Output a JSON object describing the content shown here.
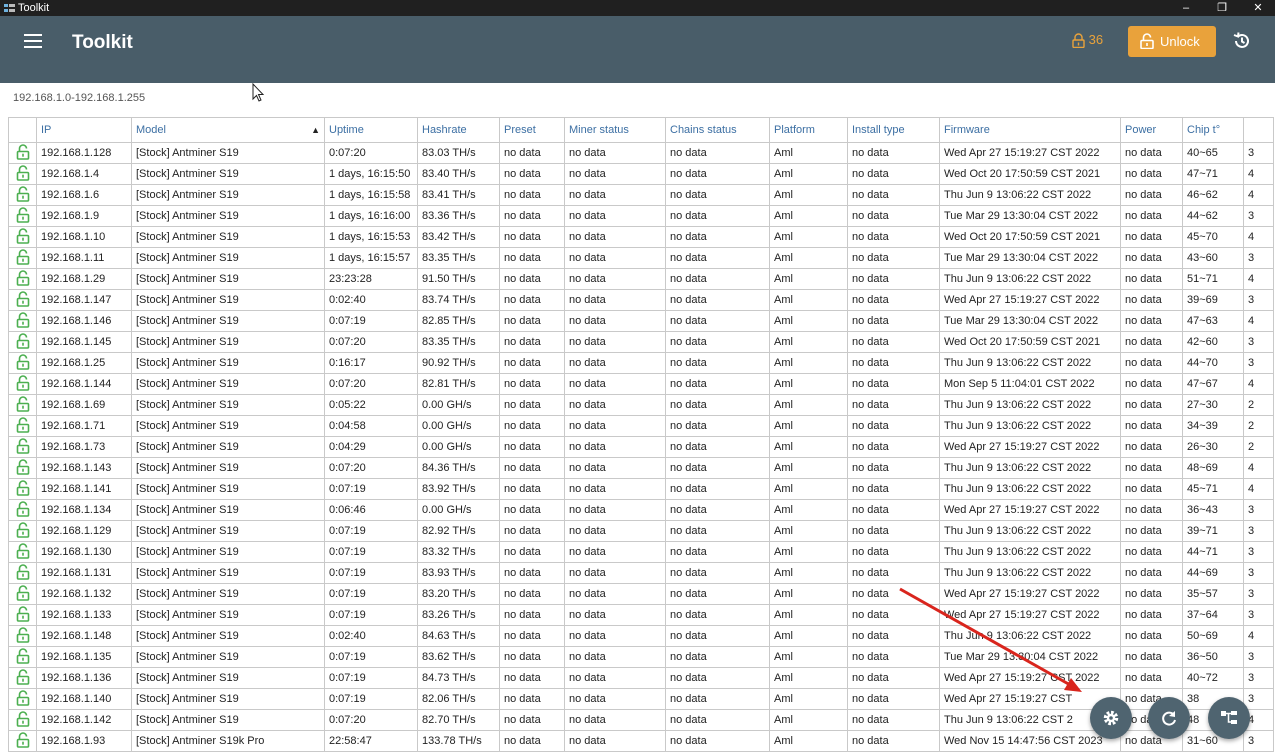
{
  "window": {
    "title": "Toolkit",
    "controls": [
      "–",
      "❐",
      "✕"
    ]
  },
  "header": {
    "title": "Toolkit",
    "lock_count": "36",
    "unlock_label": "Unlock"
  },
  "range": {
    "text": "192.168.1.0-192.168.1.255"
  },
  "table": {
    "columns": [
      "",
      "IP",
      "Model",
      "Uptime",
      "Hashrate",
      "Preset",
      "Miner status",
      "Chains status",
      "Platform",
      "Install type",
      "Firmware",
      "Power",
      "Chip t°",
      ""
    ],
    "sort_indicator": "▲",
    "rows": [
      [
        "192.168.1.128",
        "[Stock] Antminer S19",
        "0:07:20",
        "83.03 TH/s",
        "no data",
        "no data",
        "no data",
        "Aml",
        "no data",
        "Wed Apr 27 15:19:27 CST 2022",
        "no data",
        "40~65",
        "3"
      ],
      [
        "192.168.1.4",
        "[Stock] Antminer S19",
        "1 days, 16:15:50",
        "83.40 TH/s",
        "no data",
        "no data",
        "no data",
        "Aml",
        "no data",
        "Wed Oct 20 17:50:59 CST 2021",
        "no data",
        "47~71",
        "4"
      ],
      [
        "192.168.1.6",
        "[Stock] Antminer S19",
        "1 days, 16:15:58",
        "83.41 TH/s",
        "no data",
        "no data",
        "no data",
        "Aml",
        "no data",
        "Thu Jun  9 13:06:22 CST 2022",
        "no data",
        "46~62",
        "4"
      ],
      [
        "192.168.1.9",
        "[Stock] Antminer S19",
        "1 days, 16:16:00",
        "83.36 TH/s",
        "no data",
        "no data",
        "no data",
        "Aml",
        "no data",
        "Tue Mar 29 13:30:04 CST 2022",
        "no data",
        "44~62",
        "3"
      ],
      [
        "192.168.1.10",
        "[Stock] Antminer S19",
        "1 days, 16:15:53",
        "83.42 TH/s",
        "no data",
        "no data",
        "no data",
        "Aml",
        "no data",
        "Wed Oct 20 17:50:59 CST 2021",
        "no data",
        "45~70",
        "4"
      ],
      [
        "192.168.1.11",
        "[Stock] Antminer S19",
        "1 days, 16:15:57",
        "83.35 TH/s",
        "no data",
        "no data",
        "no data",
        "Aml",
        "no data",
        "Tue Mar 29 13:30:04 CST 2022",
        "no data",
        "43~60",
        "3"
      ],
      [
        "192.168.1.29",
        "[Stock] Antminer S19",
        "23:23:28",
        "91.50 TH/s",
        "no data",
        "no data",
        "no data",
        "Aml",
        "no data",
        "Thu Jun  9 13:06:22 CST 2022",
        "no data",
        "51~71",
        "4"
      ],
      [
        "192.168.1.147",
        "[Stock] Antminer S19",
        "0:02:40",
        "83.74 TH/s",
        "no data",
        "no data",
        "no data",
        "Aml",
        "no data",
        "Wed Apr 27 15:19:27 CST 2022",
        "no data",
        "39~69",
        "3"
      ],
      [
        "192.168.1.146",
        "[Stock] Antminer S19",
        "0:07:19",
        "82.85 TH/s",
        "no data",
        "no data",
        "no data",
        "Aml",
        "no data",
        "Tue Mar 29 13:30:04 CST 2022",
        "no data",
        "47~63",
        "4"
      ],
      [
        "192.168.1.145",
        "[Stock] Antminer S19",
        "0:07:20",
        "83.35 TH/s",
        "no data",
        "no data",
        "no data",
        "Aml",
        "no data",
        "Wed Oct 20 17:50:59 CST 2021",
        "no data",
        "42~60",
        "3"
      ],
      [
        "192.168.1.25",
        "[Stock] Antminer S19",
        "0:16:17",
        "90.92 TH/s",
        "no data",
        "no data",
        "no data",
        "Aml",
        "no data",
        "Thu Jun  9 13:06:22 CST 2022",
        "no data",
        "44~70",
        "3"
      ],
      [
        "192.168.1.144",
        "[Stock] Antminer S19",
        "0:07:20",
        "82.81 TH/s",
        "no data",
        "no data",
        "no data",
        "Aml",
        "no data",
        "Mon Sep  5 11:04:01 CST 2022",
        "no data",
        "47~67",
        "4"
      ],
      [
        "192.168.1.69",
        "[Stock] Antminer S19",
        "0:05:22",
        "0.00 GH/s",
        "no data",
        "no data",
        "no data",
        "Aml",
        "no data",
        "Thu Jun  9 13:06:22 CST 2022",
        "no data",
        "27~30",
        "2"
      ],
      [
        "192.168.1.71",
        "[Stock] Antminer S19",
        "0:04:58",
        "0.00 GH/s",
        "no data",
        "no data",
        "no data",
        "Aml",
        "no data",
        "Thu Jun  9 13:06:22 CST 2022",
        "no data",
        "34~39",
        "2"
      ],
      [
        "192.168.1.73",
        "[Stock] Antminer S19",
        "0:04:29",
        "0.00 GH/s",
        "no data",
        "no data",
        "no data",
        "Aml",
        "no data",
        "Wed Apr 27 15:19:27 CST 2022",
        "no data",
        "26~30",
        "2"
      ],
      [
        "192.168.1.143",
        "[Stock] Antminer S19",
        "0:07:20",
        "84.36 TH/s",
        "no data",
        "no data",
        "no data",
        "Aml",
        "no data",
        "Thu Jun  9 13:06:22 CST 2022",
        "no data",
        "48~69",
        "4"
      ],
      [
        "192.168.1.141",
        "[Stock] Antminer S19",
        "0:07:19",
        "83.92 TH/s",
        "no data",
        "no data",
        "no data",
        "Aml",
        "no data",
        "Thu Jun  9 13:06:22 CST 2022",
        "no data",
        "45~71",
        "4"
      ],
      [
        "192.168.1.134",
        "[Stock] Antminer S19",
        "0:06:46",
        "0.00 GH/s",
        "no data",
        "no data",
        "no data",
        "Aml",
        "no data",
        "Wed Apr 27 15:19:27 CST 2022",
        "no data",
        "36~43",
        "3"
      ],
      [
        "192.168.1.129",
        "[Stock] Antminer S19",
        "0:07:19",
        "82.92 TH/s",
        "no data",
        "no data",
        "no data",
        "Aml",
        "no data",
        "Thu Jun  9 13:06:22 CST 2022",
        "no data",
        "39~71",
        "3"
      ],
      [
        "192.168.1.130",
        "[Stock] Antminer S19",
        "0:07:19",
        "83.32 TH/s",
        "no data",
        "no data",
        "no data",
        "Aml",
        "no data",
        "Thu Jun  9 13:06:22 CST 2022",
        "no data",
        "44~71",
        "3"
      ],
      [
        "192.168.1.131",
        "[Stock] Antminer S19",
        "0:07:19",
        "83.93 TH/s",
        "no data",
        "no data",
        "no data",
        "Aml",
        "no data",
        "Thu Jun  9 13:06:22 CST 2022",
        "no data",
        "44~69",
        "3"
      ],
      [
        "192.168.1.132",
        "[Stock] Antminer S19",
        "0:07:19",
        "83.20 TH/s",
        "no data",
        "no data",
        "no data",
        "Aml",
        "no data",
        "Wed Apr 27 15:19:27 CST 2022",
        "no data",
        "35~57",
        "3"
      ],
      [
        "192.168.1.133",
        "[Stock] Antminer S19",
        "0:07:19",
        "83.26 TH/s",
        "no data",
        "no data",
        "no data",
        "Aml",
        "no data",
        "Wed Apr 27 15:19:27 CST 2022",
        "no data",
        "37~64",
        "3"
      ],
      [
        "192.168.1.148",
        "[Stock] Antminer S19",
        "0:02:40",
        "84.63 TH/s",
        "no data",
        "no data",
        "no data",
        "Aml",
        "no data",
        "Thu Jun  9 13:06:22 CST 2022",
        "no data",
        "50~69",
        "4"
      ],
      [
        "192.168.1.135",
        "[Stock] Antminer S19",
        "0:07:19",
        "83.62 TH/s",
        "no data",
        "no data",
        "no data",
        "Aml",
        "no data",
        "Tue Mar 29 13:30:04 CST 2022",
        "no data",
        "36~50",
        "3"
      ],
      [
        "192.168.1.136",
        "[Stock] Antminer S19",
        "0:07:19",
        "84.73 TH/s",
        "no data",
        "no data",
        "no data",
        "Aml",
        "no data",
        "Wed Apr 27 15:19:27 CST 2022",
        "no data",
        "40~72",
        "3"
      ],
      [
        "192.168.1.140",
        "[Stock] Antminer S19",
        "0:07:19",
        "82.06 TH/s",
        "no data",
        "no data",
        "no data",
        "Aml",
        "no data",
        "Wed Apr 27 15:19:27 CST",
        "no data",
        "38",
        "3"
      ],
      [
        "192.168.1.142",
        "[Stock] Antminer S19",
        "0:07:20",
        "82.70 TH/s",
        "no data",
        "no data",
        "no data",
        "Aml",
        "no data",
        "Thu Jun  9 13:06:22 CST 2",
        "no data",
        "48",
        "4"
      ],
      [
        "192.168.1.93",
        "[Stock] Antminer S19k Pro",
        "22:58:47",
        "133.78 TH/s",
        "no data",
        "no data",
        "no data",
        "Aml",
        "no data",
        "Wed Nov 15 14:47:56 CST 2023",
        "no data",
        "31~60",
        "3"
      ]
    ]
  },
  "colors": {
    "header_bg": "#495d69",
    "accent": "#e9a23b",
    "lock_icon": "#4caf50",
    "link_header": "#3c6fa3",
    "annotation_arrow": "#d9251d"
  },
  "fabs": [
    {
      "name": "settings",
      "icon": "gear-icon"
    },
    {
      "name": "refresh",
      "icon": "refresh-icon"
    },
    {
      "name": "network",
      "icon": "network-icon"
    }
  ]
}
